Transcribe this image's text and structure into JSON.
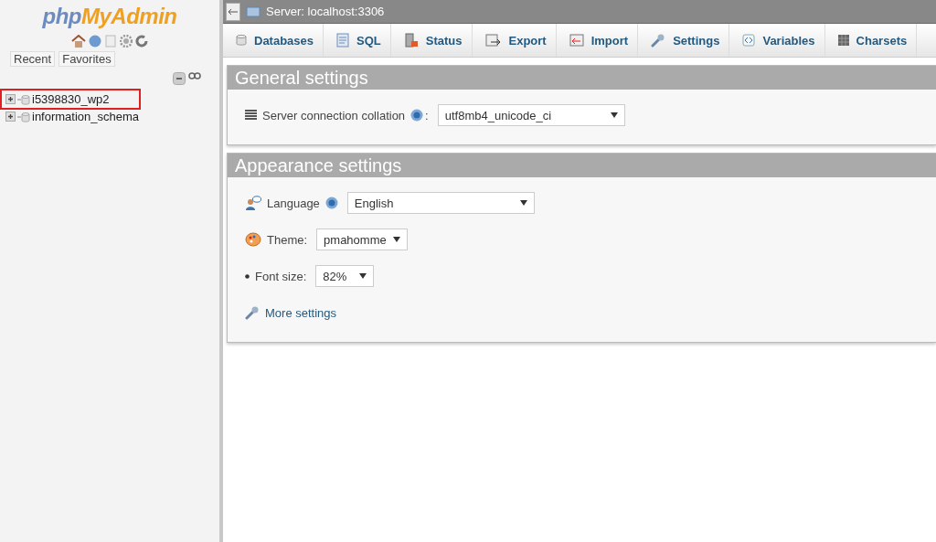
{
  "sidebar": {
    "logo": [
      "php",
      "MyAdmin"
    ],
    "nav_buttons": [
      "Recent",
      "Favorites"
    ],
    "tree": [
      {
        "name": "i5398830_wp2",
        "expanded": false,
        "highlighted": true
      },
      {
        "name": "information_schema",
        "expanded": false,
        "highlighted": false
      }
    ]
  },
  "breadcrumb": "Server: localhost:3306",
  "tabs": [
    {
      "label": "Databases",
      "kind": "database",
      "selected": false
    },
    {
      "label": "SQL",
      "kind": "sql",
      "selected": false
    },
    {
      "label": "Status",
      "kind": "status",
      "selected": false
    },
    {
      "label": "Export",
      "kind": "export",
      "selected": false
    },
    {
      "label": "Import",
      "kind": "import",
      "selected": false
    },
    {
      "label": "Settings",
      "kind": "wrench",
      "selected": false
    },
    {
      "label": "Variables",
      "kind": "variables",
      "selected": false
    },
    {
      "label": "Charsets",
      "kind": "charsets",
      "selected": false
    }
  ],
  "panels": [
    {
      "title": "General settings",
      "rows": [
        {
          "kind": "collation",
          "label": "Server connection collation",
          "help": true,
          "colon": ":",
          "value": "utf8mb4_unicode_ci"
        }
      ]
    },
    {
      "title": "Appearance settings",
      "rows": [
        {
          "kind": "language",
          "label": "Language",
          "help": true,
          "value": "English"
        },
        {
          "kind": "theme",
          "label": "Theme:",
          "help": false,
          "value": "pmahomme"
        },
        {
          "kind": "fontsize",
          "label": "Font size:",
          "help": false,
          "value": "82%"
        },
        {
          "kind": "link",
          "label": "More settings"
        }
      ]
    }
  ]
}
